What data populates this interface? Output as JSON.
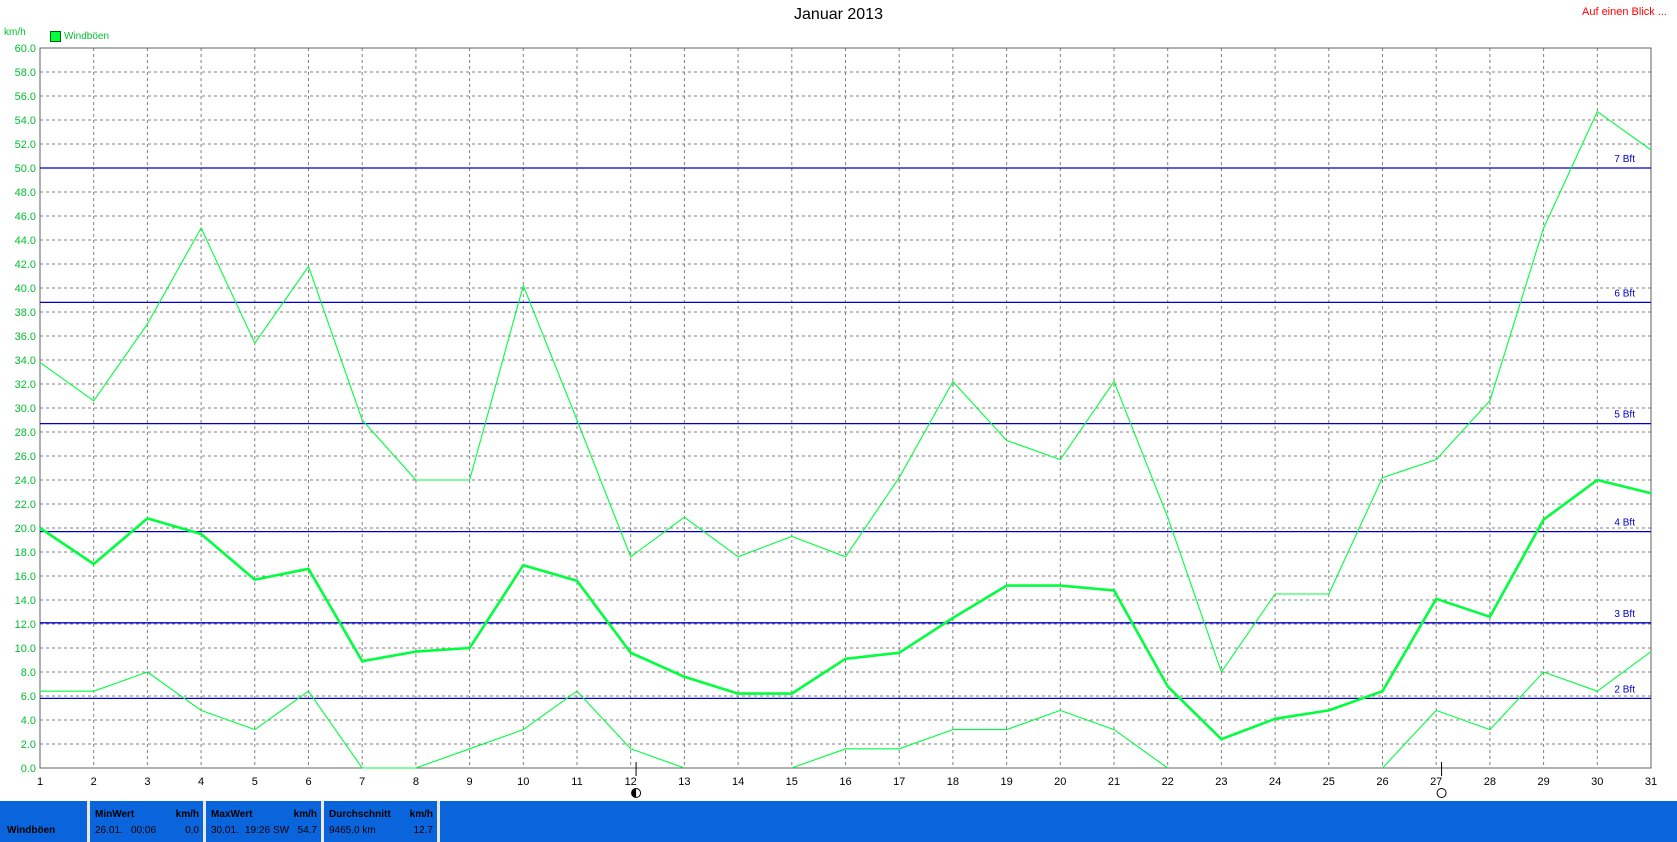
{
  "title": "Januar 2013",
  "top_link": "Auf einen Blick ...",
  "unit_label": "km/h",
  "legend_label": "Windböen",
  "colors": {
    "series": "#00ff3c",
    "grid": "#808080",
    "beaufort": "#0000c8",
    "footer": "#0a64dc",
    "link": "#ff0000"
  },
  "chart_data": {
    "type": "line",
    "title": "Januar 2013",
    "ylabel": "km/h",
    "ylim": [
      0,
      60
    ],
    "xlim": [
      1,
      31
    ],
    "y_ticks": [
      "0.0",
      "2.0",
      "4.0",
      "6.0",
      "8.0",
      "10.0",
      "12.0",
      "14.0",
      "16.0",
      "18.0",
      "20.0",
      "22.0",
      "24.0",
      "26.0",
      "28.0",
      "30.0",
      "32.0",
      "34.0",
      "36.0",
      "38.0",
      "40.0",
      "42.0",
      "44.0",
      "46.0",
      "48.0",
      "50.0",
      "52.0",
      "54.0",
      "56.0",
      "58.0",
      "60.0"
    ],
    "x_ticks": [
      "1",
      "2",
      "3",
      "4",
      "5",
      "6",
      "7",
      "8",
      "9",
      "10",
      "11",
      "12",
      "13",
      "14",
      "15",
      "16",
      "17",
      "18",
      "19",
      "20",
      "21",
      "22",
      "23",
      "24",
      "25",
      "26",
      "27",
      "28",
      "29",
      "30",
      "31"
    ],
    "grid": true,
    "legend": "top-left",
    "series": [
      {
        "name": "Windböen",
        "role": "max",
        "values": [
          33.8,
          30.6,
          37.0,
          45.0,
          35.4,
          41.8,
          29.0,
          24.0,
          24.0,
          40.2,
          29.0,
          17.6,
          20.9,
          17.6,
          19.3,
          17.6,
          24.2,
          32.2,
          27.3,
          25.7,
          32.2,
          20.9,
          8.0,
          14.5,
          14.5,
          24.2,
          25.7,
          30.6,
          45.0,
          54.7,
          51.5
        ]
      },
      {
        "name": "Windböen",
        "role": "avg",
        "values": [
          20.0,
          17.0,
          20.8,
          19.5,
          15.7,
          16.6,
          8.9,
          9.7,
          10.0,
          16.9,
          15.6,
          9.6,
          7.6,
          6.2,
          6.2,
          9.1,
          9.6,
          12.5,
          15.2,
          15.2,
          14.8,
          6.8,
          2.4,
          4.1,
          4.8,
          6.4,
          14.1,
          12.6,
          20.7,
          24.0,
          22.9
        ]
      },
      {
        "name": "Windböen",
        "role": "min",
        "values": [
          6.4,
          6.4,
          8.0,
          4.8,
          3.2,
          6.4,
          0.0,
          0.0,
          1.6,
          3.2,
          6.4,
          1.6,
          0.0,
          null,
          0.0,
          1.6,
          1.6,
          3.2,
          3.2,
          4.8,
          3.2,
          0.0,
          null,
          null,
          null,
          0.0,
          4.8,
          3.2,
          8.0,
          6.4,
          9.7
        ]
      }
    ],
    "reference_lines": [
      {
        "label": "2 Bft",
        "y": 5.8
      },
      {
        "label": "3 Bft",
        "y": 12.1
      },
      {
        "label": "4 Bft",
        "y": 19.7
      },
      {
        "label": "5 Bft",
        "y": 28.7
      },
      {
        "label": "6 Bft",
        "y": 38.8
      },
      {
        "label": "7 Bft",
        "y": 50.0
      }
    ],
    "moon_phases": [
      {
        "day": 12,
        "phase": "half"
      },
      {
        "day": 27,
        "phase": "full"
      }
    ]
  },
  "footer": {
    "row_label": "Windböen",
    "min": {
      "header": "MinWert",
      "unit": "km/h",
      "date": "26.01.",
      "time": "00:06",
      "value": "0.0"
    },
    "max": {
      "header": "MaxWert",
      "unit": "km/h",
      "date": "30.01.",
      "time": "19:26",
      "dir": "SW",
      "value": "54.7"
    },
    "avg": {
      "header": "Durchschnitt",
      "unit": "km/h",
      "distance": "9465.0 km",
      "value": "12.7"
    }
  }
}
